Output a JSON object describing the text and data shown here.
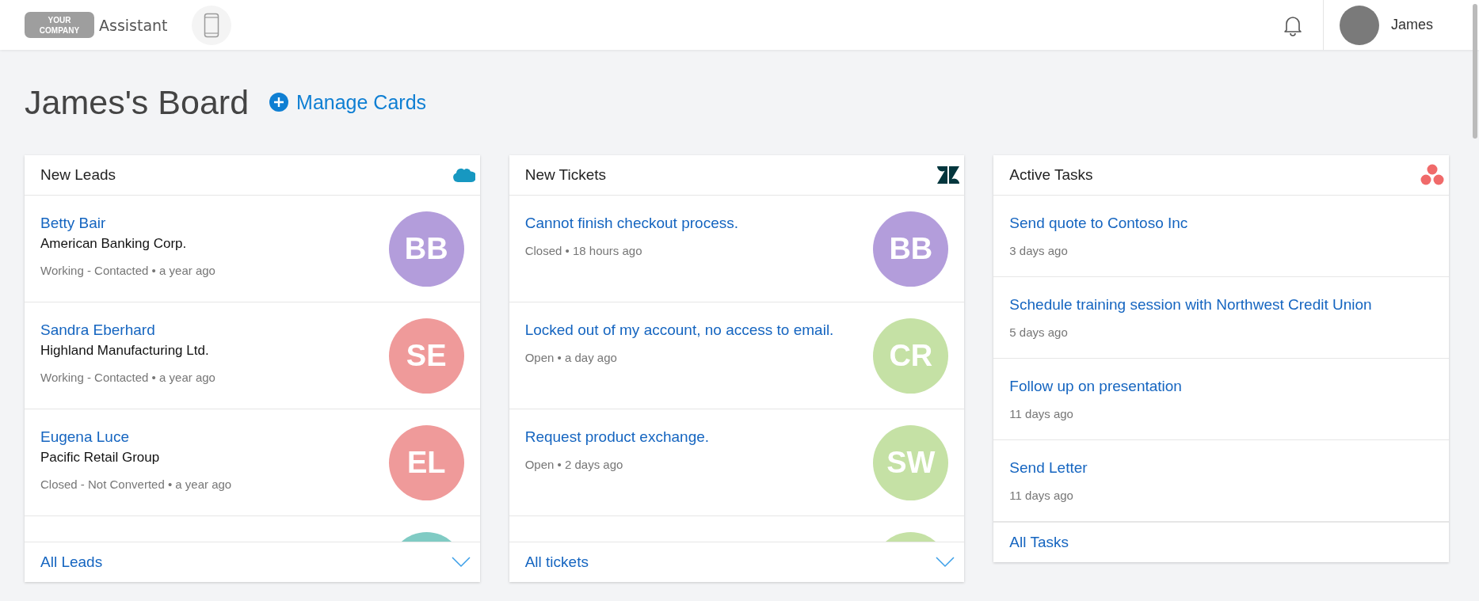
{
  "header": {
    "logo_top": "YOUR",
    "logo_bottom": "COMPANY",
    "app_name": "Assistant",
    "user_name": "James"
  },
  "board": {
    "title": "James's Board",
    "manage_button": "Manage Cards"
  },
  "cards": [
    {
      "title": "New Leads",
      "separator": "•",
      "kind": "leads",
      "footer": "All Leads",
      "expandable": true,
      "items": [
        {
          "title": "Betty Bair",
          "subtitle": "American Banking Corp.",
          "status": "Working - Contacted",
          "time": "a year ago",
          "initials": "BB",
          "color": "#b39ddb"
        },
        {
          "title": "Sandra Eberhard",
          "subtitle": "Highland Manufacturing Ltd.",
          "status": "Working - Contacted",
          "time": "a year ago",
          "initials": "SE",
          "color": "#ef9a9a"
        },
        {
          "title": "Eugena Luce",
          "subtitle": "Pacific Retail Group",
          "status": "Closed - Not Converted",
          "time": "a year ago",
          "initials": "EL",
          "color": "#ef9a9a"
        }
      ],
      "partial_item": {
        "color": "#80cbc4"
      }
    },
    {
      "title": "New Tickets",
      "separator": "•",
      "kind": "tickets",
      "footer": "All tickets",
      "expandable": true,
      "items": [
        {
          "title": "Cannot finish checkout process.",
          "status": "Closed",
          "time": "18 hours ago",
          "initials": "BB",
          "color": "#b39ddb"
        },
        {
          "title": "Locked out of my account, no access to email.",
          "status": "Open",
          "time": "a day ago",
          "initials": "CR",
          "color": "#c5e1a5"
        },
        {
          "title": "Request product exchange.",
          "status": "Open",
          "time": "2 days ago",
          "initials": "SW",
          "color": "#c5e1a5"
        }
      ],
      "partial_item": {
        "color": "#c5e1a5"
      }
    },
    {
      "title": "Active Tasks",
      "kind": "tasks",
      "footer": "All Tasks",
      "expandable": false,
      "items": [
        {
          "title": "Send quote to Contoso Inc",
          "time": "3 days ago"
        },
        {
          "title": "Schedule training session with Northwest Credit Union",
          "time": "5 days ago"
        },
        {
          "title": "Follow up on presentation",
          "time": "11 days ago"
        },
        {
          "title": "Send Letter",
          "time": "11 days ago"
        }
      ]
    }
  ]
}
